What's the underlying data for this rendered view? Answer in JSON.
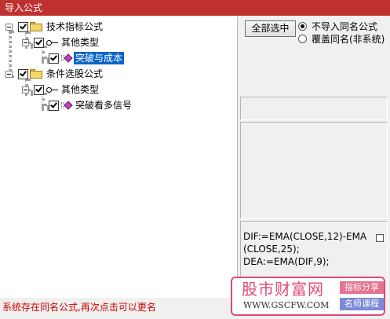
{
  "window": {
    "title": "导入公式"
  },
  "tree": {
    "groups": [
      {
        "label": "技术指标公式",
        "checked": true,
        "expanded": true,
        "children": [
          {
            "label": "其他类型",
            "checked": true,
            "expanded": true,
            "children": [
              {
                "label": "突破与成本",
                "checked": true,
                "selected": true
              }
            ]
          }
        ]
      },
      {
        "label": "条件选股公式",
        "checked": true,
        "expanded": true,
        "children": [
          {
            "label": "其他类型",
            "checked": true,
            "expanded": true,
            "children": [
              {
                "label": "突破看多信号",
                "checked": true,
                "selected": false
              }
            ]
          }
        ]
      }
    ]
  },
  "options": {
    "select_all_label": "全部选中",
    "radio_options": [
      {
        "label": "不导入同名公式",
        "selected": true
      },
      {
        "label": "覆盖同名(非系统)",
        "selected": false
      }
    ]
  },
  "formula_preview": {
    "lines": [
      "DIF:=EMA(CLOSE,12)-EMA",
      "(CLOSE,25);",
      "DEA:=EMA(DIF,9);"
    ]
  },
  "watermark": {
    "title": "股市财富网",
    "url": "WWW.GSCFW.COM",
    "tag1": "指标分享",
    "tag2": "名师课程"
  },
  "status": {
    "message": "系统存在同名公式,再次点击可以更名",
    "color": "#d00000"
  },
  "colors": {
    "titlebar": "#c0302f",
    "selection": "#0a64c8",
    "watermark_accent": "#e04a76"
  }
}
